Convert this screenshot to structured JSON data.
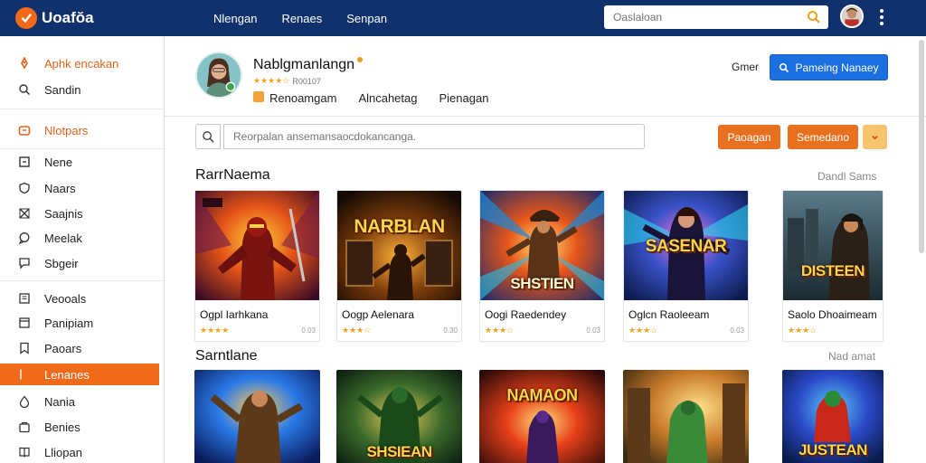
{
  "app": {
    "name": "Uoafŏa"
  },
  "topnav": [
    {
      "label": "Nlengan"
    },
    {
      "label": "Renaes"
    },
    {
      "label": "Senpan"
    }
  ],
  "top_search": {
    "placeholder": "Oaslaloan"
  },
  "sidebar": {
    "items": [
      {
        "label": "Aphk encakan",
        "icon": "rocket-icon",
        "style": "accent"
      },
      {
        "label": "Sandin",
        "icon": "search-icon"
      },
      {
        "label": "Nlotpars",
        "icon": "gamepad-icon",
        "style": "accent"
      },
      {
        "label": "Nene",
        "icon": "square-icon"
      },
      {
        "label": "Naars",
        "icon": "shield-icon"
      },
      {
        "label": "Saajnis",
        "icon": "cross-icon"
      },
      {
        "label": "Meelak",
        "icon": "chat-icon"
      },
      {
        "label": "Sbgeir",
        "icon": "message-icon"
      },
      {
        "label": "Veooals",
        "icon": "list-icon"
      },
      {
        "label": "Panipiam",
        "icon": "window-icon"
      },
      {
        "label": "Paoars",
        "icon": "bookmark-icon"
      },
      {
        "label": "Lenanes",
        "icon": "flag-icon",
        "style": "active"
      },
      {
        "label": "Nania",
        "icon": "drop-icon"
      },
      {
        "label": "Benies",
        "icon": "bag-icon"
      },
      {
        "label": "Lliopan",
        "icon": "book-icon"
      }
    ]
  },
  "profile": {
    "name": "Nablgmanlangn",
    "rating_text": "R00107",
    "tabs": [
      "Renoamgam",
      "Alncahetag",
      "Pienagan"
    ],
    "owner_label": "Gmer",
    "primary_button": "Pameing Nanaey"
  },
  "filter": {
    "placeholder": "Reorpalan ansemansaocdokancanga.",
    "button_1": "Paoagan",
    "button_2": "Semedano"
  },
  "sections": [
    {
      "title": "RarrNaema",
      "link": "Dandl Sams"
    },
    {
      "title": "Sarntlane",
      "link": "Nad amat"
    }
  ],
  "cards_row1": [
    {
      "caption": "Ogpl Iarhkana",
      "meta": "0.03",
      "art_text": ""
    },
    {
      "caption": "Oogp Aelenara",
      "meta": "0.30",
      "art_text": "NARBLAN"
    },
    {
      "caption": "Oogi Raedendey",
      "meta": "0.03",
      "art_text": "SHSTIEN"
    },
    {
      "caption": "Oglcn Raoleeam",
      "meta": "0.03",
      "art_text": "SASENAR"
    },
    {
      "caption": "Saolo Dhoaimeam",
      "meta": "",
      "art_text": "DISTEEN"
    }
  ],
  "cards_row2": [
    {
      "art_text": ""
    },
    {
      "art_text": "SHSIEAN"
    },
    {
      "art_text": "NAMAON"
    },
    {
      "art_text": ""
    },
    {
      "art_text": "JUSTEAN"
    }
  ],
  "colors": {
    "topbar": "#10316b",
    "accent_orange": "#f06a1a",
    "primary_blue": "#1b6fe0"
  }
}
